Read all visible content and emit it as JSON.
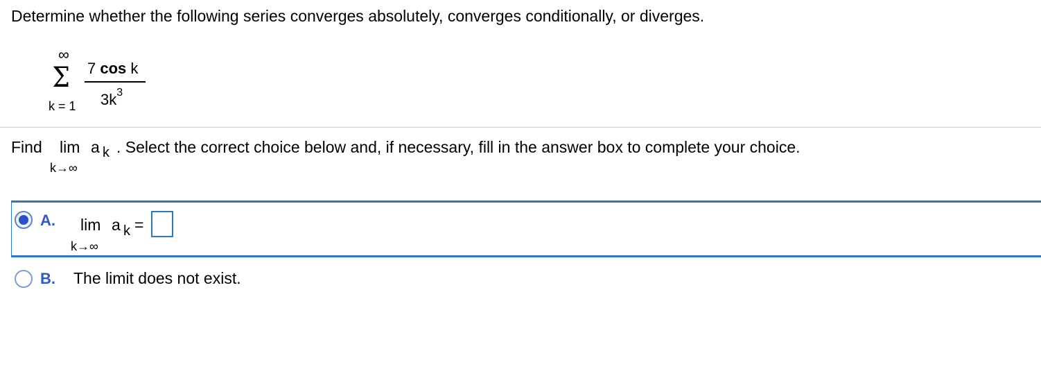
{
  "question": {
    "text": "Determine whether the following series converges absolutely, converges conditionally, or diverges."
  },
  "series": {
    "upper": "∞",
    "sigma": "Σ",
    "lower": "k = 1",
    "numerator_coef": "7 ",
    "numerator_func": "cos",
    "numerator_var": " k",
    "denominator_base": "3k",
    "denominator_exp": "3"
  },
  "find": {
    "label": "Find",
    "lim": "lim",
    "a": "a",
    "sub": "k",
    "rest": ". Select the correct choice below and, if necessary, fill in the answer box to complete your choice.",
    "under": "k→∞"
  },
  "choices": {
    "a": {
      "letter": "A.",
      "lim": "lim",
      "a": "a",
      "sub": "k",
      "eq": "=",
      "under": "k→∞",
      "answer_value": "",
      "selected": true
    },
    "b": {
      "letter": "B.",
      "text": "The limit does not exist.",
      "selected": false
    }
  },
  "colors": {
    "accent_blue": "#2b79c2",
    "letter_blue": "#3157c5",
    "radio_fill": "#2a4fc9",
    "divider": "#cfcfcf"
  }
}
